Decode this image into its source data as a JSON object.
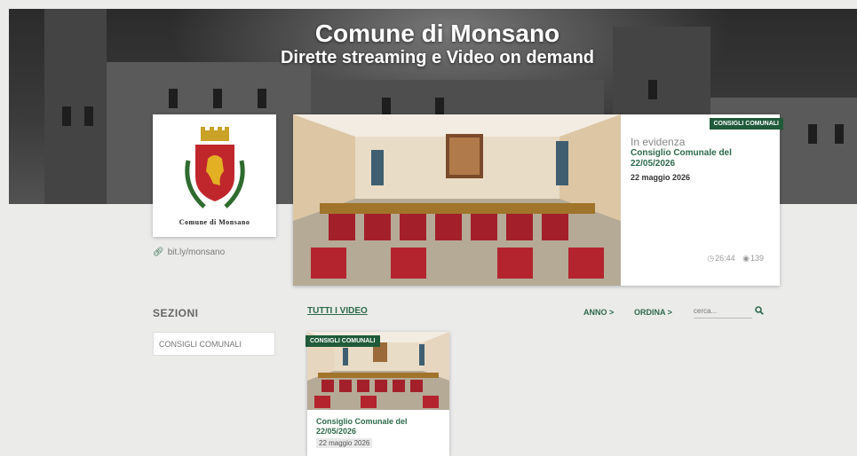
{
  "header": {
    "title": "Comune di Monsano",
    "subtitle": "Dirette streaming e Video on demand"
  },
  "logo": {
    "name": "Comune di Monsano"
  },
  "link": {
    "text": "bit.ly/monsano",
    "icon": "link-icon"
  },
  "featured": {
    "badge": "CONSIGLI COMUNALI",
    "label": "In evidenza",
    "title": "Consiglio Comunale del 22/05/2026",
    "date": "22 maggio 2026",
    "duration": "26:44",
    "views": "139"
  },
  "sections": {
    "heading": "SEZIONI",
    "items": [
      "CONSIGLI COMUNALI"
    ]
  },
  "filters": {
    "all_videos": "TUTTI I VIDEO",
    "year": "ANNO >",
    "sort": "ORDINA >",
    "search_placeholder": "cerca..."
  },
  "videos": [
    {
      "badge": "CONSIGLI COMUNALI",
      "title": "Consiglio Comunale del 22/05/2026",
      "date": "22 maggio 2026"
    }
  ],
  "colors": {
    "accent": "#2d6a4a",
    "badge_bg": "#1f5a3a",
    "chair": "#a3202b"
  }
}
